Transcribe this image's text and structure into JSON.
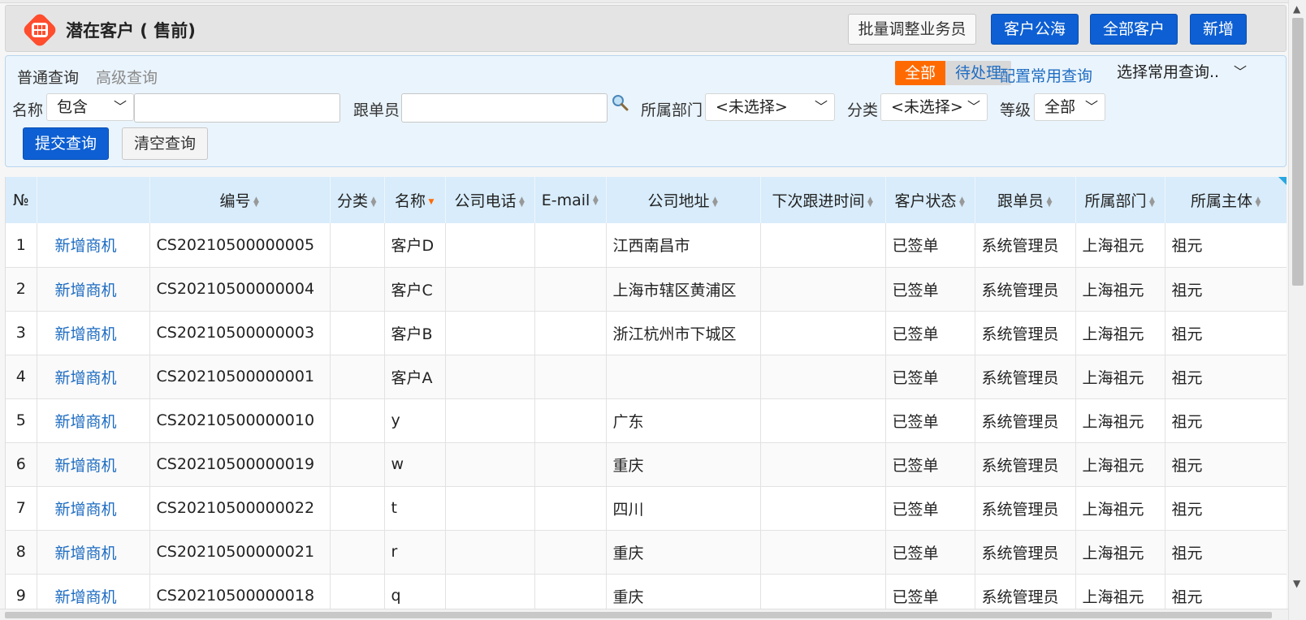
{
  "header": {
    "title": "潜在客户 ( 售前)",
    "logo_icon": "grid-icon",
    "buttons": {
      "batch_adjust": "批量调整业务员",
      "public_pool": "客户公海",
      "all_customers": "全部客户",
      "add_new": "新增"
    }
  },
  "query": {
    "tabs": {
      "normal": "普通查询",
      "advanced": "高级查询"
    },
    "toggle": {
      "all": "全部",
      "pending": "待处理"
    },
    "config_link": "配置常用查询",
    "common_query_select": "选择常用查询..",
    "fields": {
      "name_label": "名称",
      "name_operator": "包含",
      "name_value": "",
      "owner_label": "跟单员",
      "owner_value": "",
      "dept_label": "所属部门",
      "dept_value": "<未选择>",
      "category_label": "分类",
      "category_value": "<未选择>",
      "level_label": "等级",
      "level_value": "全部"
    },
    "submit": "提交查询",
    "clear": "清空查询"
  },
  "table": {
    "columns": [
      "№",
      "",
      "编号",
      "分类",
      "名称",
      "公司电话",
      "E-mail",
      "公司地址",
      "下次跟进时间",
      "客户状态",
      "跟单员",
      "所属部门",
      "所属主体"
    ],
    "rows": [
      {
        "no": "1",
        "action": "新增商机",
        "code": "CS20210500000005",
        "category": "",
        "name": "客户D",
        "phone": "",
        "email": "",
        "address": "江西南昌市",
        "next": "",
        "status": "已签单",
        "owner": "系统管理员",
        "dept": "上海祖元",
        "entity": "祖元"
      },
      {
        "no": "2",
        "action": "新增商机",
        "code": "CS20210500000004",
        "category": "",
        "name": "客户C",
        "phone": "",
        "email": "",
        "address": "上海市辖区黄浦区",
        "next": "",
        "status": "已签单",
        "owner": "系统管理员",
        "dept": "上海祖元",
        "entity": "祖元"
      },
      {
        "no": "3",
        "action": "新增商机",
        "code": "CS20210500000003",
        "category": "",
        "name": "客户B",
        "phone": "",
        "email": "",
        "address": "浙江杭州市下城区",
        "next": "",
        "status": "已签单",
        "owner": "系统管理员",
        "dept": "上海祖元",
        "entity": "祖元"
      },
      {
        "no": "4",
        "action": "新增商机",
        "code": "CS20210500000001",
        "category": "",
        "name": "客户A",
        "phone": "",
        "email": "",
        "address": "",
        "next": "",
        "status": "已签单",
        "owner": "系统管理员",
        "dept": "上海祖元",
        "entity": "祖元"
      },
      {
        "no": "5",
        "action": "新增商机",
        "code": "CS20210500000010",
        "category": "",
        "name": "y",
        "phone": "",
        "email": "",
        "address": "广东",
        "next": "",
        "status": "已签单",
        "owner": "系统管理员",
        "dept": "上海祖元",
        "entity": "祖元"
      },
      {
        "no": "6",
        "action": "新增商机",
        "code": "CS20210500000019",
        "category": "",
        "name": "w",
        "phone": "",
        "email": "",
        "address": "重庆",
        "next": "",
        "status": "已签单",
        "owner": "系统管理员",
        "dept": "上海祖元",
        "entity": "祖元"
      },
      {
        "no": "7",
        "action": "新增商机",
        "code": "CS20210500000022",
        "category": "",
        "name": "t",
        "phone": "",
        "email": "",
        "address": "四川",
        "next": "",
        "status": "已签单",
        "owner": "系统管理员",
        "dept": "上海祖元",
        "entity": "祖元"
      },
      {
        "no": "8",
        "action": "新增商机",
        "code": "CS20210500000021",
        "category": "",
        "name": "r",
        "phone": "",
        "email": "",
        "address": "重庆",
        "next": "",
        "status": "已签单",
        "owner": "系统管理员",
        "dept": "上海祖元",
        "entity": "祖元"
      },
      {
        "no": "9",
        "action": "新增商机",
        "code": "CS20210500000018",
        "category": "",
        "name": "q",
        "phone": "",
        "email": "",
        "address": "重庆",
        "next": "",
        "status": "已签单",
        "owner": "系统管理员",
        "dept": "上海祖元",
        "entity": "祖元"
      }
    ]
  },
  "colors": {
    "accent_blue": "#0d5fd3",
    "link_blue": "#1f6dc2",
    "orange": "#ff6a00",
    "header_bg": "#d8ecfb"
  }
}
